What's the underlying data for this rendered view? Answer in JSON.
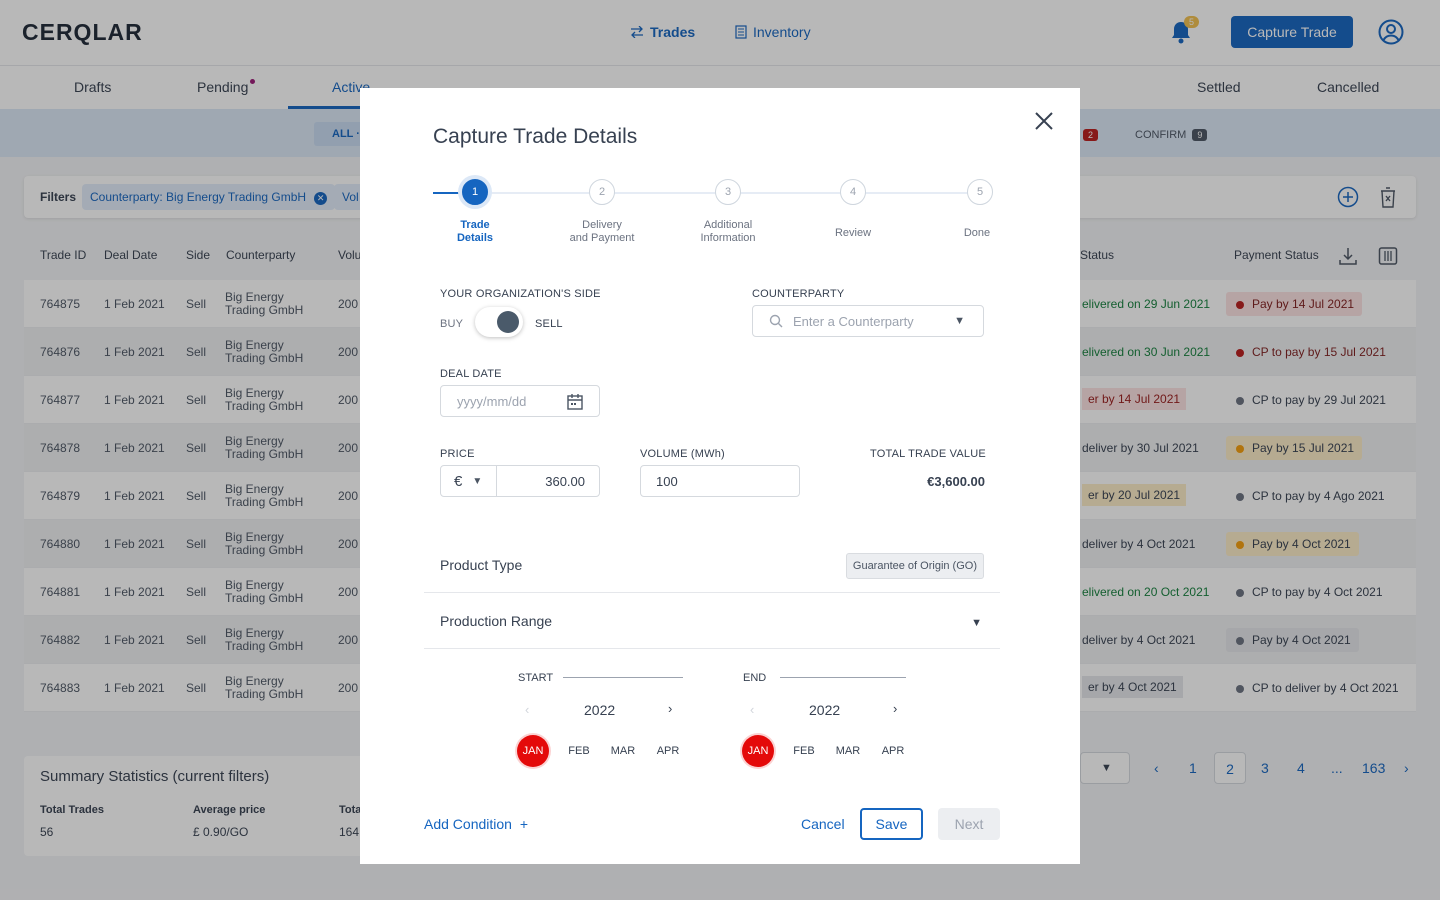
{
  "app": {
    "logo": "CERQLAR"
  },
  "nav": {
    "trades": "Trades",
    "inventory": "Inventory",
    "notif_count": "5",
    "capture_button": "Capture Trade"
  },
  "tabs": {
    "drafts": "Drafts",
    "pending": "Pending",
    "active": "Active",
    "settled": "Settled",
    "cancelled": "Cancelled"
  },
  "status_bar": {
    "all": "ALL ·",
    "confirm": "CONFIRM",
    "confirm_count": "9",
    "other_count": "2"
  },
  "filters": {
    "label": "Filters",
    "chip1": "Counterparty: Big Energy Trading GmbH",
    "chip2": "Vol"
  },
  "table": {
    "headers": {
      "trade_id": "Trade ID",
      "deal_date": "Deal Date",
      "side": "Side",
      "counterparty": "Counterparty",
      "volume": "Volu",
      "status": "Status",
      "payment_status": "Payment Status"
    },
    "rows": [
      {
        "id": "764875",
        "date": "1 Feb 2021",
        "side": "Sell",
        "cp": "Big Energy Trading GmbH",
        "vol": "200",
        "status": "elivered on 29 Jun 2021",
        "pay": "Pay by 14 Jul 2021"
      },
      {
        "id": "764876",
        "date": "1 Feb 2021",
        "side": "Sell",
        "cp": "Big Energy Trading GmbH",
        "vol": "200",
        "status": "elivered on 30 Jun 2021",
        "pay": "CP to pay by 15 Jul 2021"
      },
      {
        "id": "764877",
        "date": "1 Feb 2021",
        "side": "Sell",
        "cp": "Big Energy Trading GmbH",
        "vol": "200",
        "status": "er by 14 Jul 2021",
        "pay": "CP to pay by 29 Jul 2021"
      },
      {
        "id": "764878",
        "date": "1 Feb 2021",
        "side": "Sell",
        "cp": "Big Energy Trading GmbH",
        "vol": "200",
        "status": "deliver by 30 Jul 2021",
        "pay": "Pay by 15 Jul 2021"
      },
      {
        "id": "764879",
        "date": "1 Feb 2021",
        "side": "Sell",
        "cp": "Big Energy Trading GmbH",
        "vol": "200",
        "status": "er by 20 Jul 2021",
        "pay": "CP to pay by 4 Ago 2021"
      },
      {
        "id": "764880",
        "date": "1 Feb 2021",
        "side": "Sell",
        "cp": "Big Energy Trading GmbH",
        "vol": "200",
        "status": "deliver by 4 Oct 2021",
        "pay": "Pay by 4 Oct 2021"
      },
      {
        "id": "764881",
        "date": "1 Feb 2021",
        "side": "Sell",
        "cp": "Big Energy Trading GmbH",
        "vol": "200",
        "status": "elivered on 20 Oct 2021",
        "pay": "CP to pay by 4 Oct 2021"
      },
      {
        "id": "764882",
        "date": "1 Feb 2021",
        "side": "Sell",
        "cp": "Big Energy Trading GmbH",
        "vol": "200",
        "status": "deliver by 4 Oct 2021",
        "pay": "Pay by 4 Oct 2021"
      },
      {
        "id": "764883",
        "date": "1 Feb 2021",
        "side": "Sell",
        "cp": "Big Energy Trading GmbH",
        "vol": "200",
        "status": "er by 4 Oct 2021",
        "pay": "CP to deliver by 4 Oct 2021"
      }
    ]
  },
  "summary": {
    "title": "Summary Statistics (current filters)",
    "total_trades_label": "Total Trades",
    "total_trades": "56",
    "avg_price_label": "Average price",
    "avg_price": "£ 0.90/GO",
    "tota_label": "Tota",
    "tota_value": "164"
  },
  "pager": {
    "p1": "1",
    "p2": "2",
    "p3": "3",
    "p4": "4",
    "ellipsis": "...",
    "last": "163"
  },
  "modal": {
    "title": "Capture Trade Details",
    "steps": [
      {
        "n": "1",
        "label": "Trade\nDetails"
      },
      {
        "n": "2",
        "label": "Delivery\nand Payment"
      },
      {
        "n": "3",
        "label": "Additional\nInformation"
      },
      {
        "n": "4",
        "label": "Review"
      },
      {
        "n": "5",
        "label": "Done"
      }
    ],
    "side_label": "YOUR ORGANIZATION'S SIDE",
    "buy": "BUY",
    "sell": "SELL",
    "counterparty_label": "COUNTERPARTY",
    "counterparty_placeholder": "Enter a Counterparty",
    "deal_date_label": "DEAL DATE",
    "deal_date_placeholder": "yyyy/mm/dd",
    "price_label": "PRICE",
    "currency": "€",
    "price": "360.00",
    "volume_label": "VOLUME (MWh)",
    "volume": "100",
    "total_label": "TOTAL TRADE VALUE",
    "total": "€3,600.00",
    "product_type_label": "Product Type",
    "product_type": "Guarantee of Origin (GO)",
    "production_range_label": "Production Range",
    "start_label": "START",
    "end_label": "END",
    "start_year": "2022",
    "end_year": "2022",
    "months": [
      "JAN",
      "FEB",
      "MAR",
      "APR"
    ],
    "add_condition": "Add Condition",
    "cancel": "Cancel",
    "save": "Save",
    "next": "Next"
  }
}
